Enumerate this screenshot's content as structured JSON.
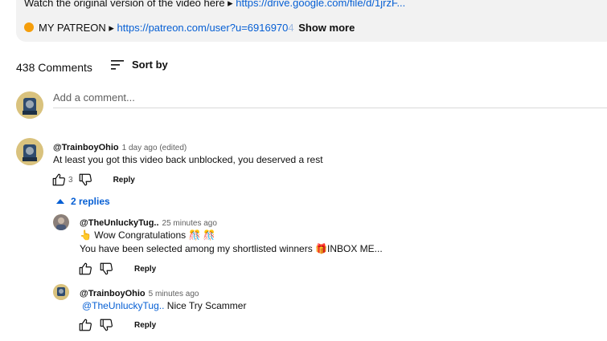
{
  "description": {
    "line1_text": "Watch the original version of the video here ▸ ",
    "line1_link": "https://drive.google.com/file/d/1jrzF...",
    "line2_text": "MY PATREON ▸ ",
    "line2_link": "https://patreon.com/user?u=6916970",
    "line2_link_fade": "4",
    "show_more": "Show more"
  },
  "comments_header": {
    "count": "438 Comments",
    "sort_label": "Sort by"
  },
  "add_comment": {
    "placeholder": "Add a comment..."
  },
  "comment": {
    "author": "@TrainboyOhio",
    "meta": "1 day ago (edited)",
    "text": "At least you got this video back unblocked, you deserved a rest",
    "likes": "3",
    "reply_label": "Reply"
  },
  "replies_toggle": "2 replies",
  "replies": [
    {
      "author": "@TheUnluckyTug..",
      "meta": "25 minutes ago",
      "line1": "👆 Wow Congratulations 🎊 🎊",
      "line2": "You have been selected among my shortlisted winners 🎁INBOX ME...",
      "reply_label": "Reply"
    },
    {
      "author": "@TrainboyOhio",
      "meta": "5 minutes ago",
      "mention": "@TheUnluckyTug..",
      "text": " Nice Try Scammer",
      "reply_label": "Reply"
    }
  ],
  "colors": {
    "link": "#065fd4",
    "text": "#0f0f0f",
    "secondary": "#606060",
    "desc_bg": "#f2f2f2"
  },
  "icons": [
    "sort-icon",
    "thumbs-up-icon",
    "thumbs-down-icon",
    "caret-up-icon",
    "orange-circle-icon"
  ]
}
